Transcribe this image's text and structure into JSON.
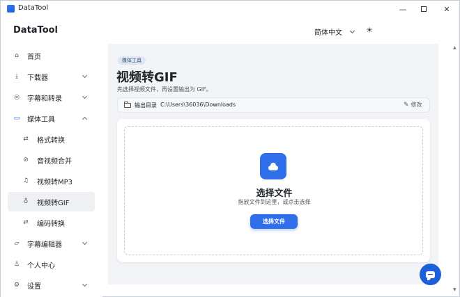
{
  "window": {
    "title": "DataTool",
    "controls": {
      "minimize": "—",
      "close": "✕"
    }
  },
  "header": {
    "brand": "DataTool",
    "language": "简体中文",
    "theme_icon": "sun-icon"
  },
  "sidebar": {
    "items": [
      {
        "label": "首页",
        "icon": "home-icon",
        "glyph": "⌂"
      },
      {
        "label": "下载器",
        "icon": "download-icon",
        "glyph": "⤓"
      },
      {
        "label": "字幕和转录",
        "icon": "mic-icon",
        "glyph": "◎"
      },
      {
        "label": "媒体工具",
        "icon": "video-icon",
        "glyph": "▭"
      },
      {
        "label": "格式转换",
        "icon": "swap-icon",
        "glyph": "⇄"
      },
      {
        "label": "音视频合并",
        "icon": "link-icon",
        "glyph": "⊘"
      },
      {
        "label": "视频转MP3",
        "icon": "music-icon",
        "glyph": "♫"
      },
      {
        "label": "视频转GIF",
        "icon": "bulb-icon",
        "glyph": "♁"
      },
      {
        "label": "编码转换",
        "icon": "swap-icon",
        "glyph": "⇄"
      },
      {
        "label": "字幕编辑器",
        "icon": "subtitle-icon",
        "glyph": "▱"
      },
      {
        "label": "个人中心",
        "icon": "user-icon",
        "glyph": "♙"
      },
      {
        "label": "设置",
        "icon": "gear-icon",
        "glyph": "⚙"
      }
    ],
    "active": "视频转GIF"
  },
  "main": {
    "tag": "媒体工具",
    "title": "视频转GIF",
    "subtitle": "先选择视频文件，再设置输出为 GIF。",
    "output": {
      "label": "输出目录",
      "path": "C:\\Users\\36036\\Downloads",
      "edit_label": "修改",
      "edit_glyph": "✎"
    },
    "dropzone": {
      "title": "选择文件",
      "hint": "拖放文件到这里，或点击选择",
      "button": "选择文件"
    }
  },
  "colors": {
    "accent": "#2f6fea",
    "active_bg": "#eef0f4",
    "content_bg": "#f2f4f7"
  }
}
